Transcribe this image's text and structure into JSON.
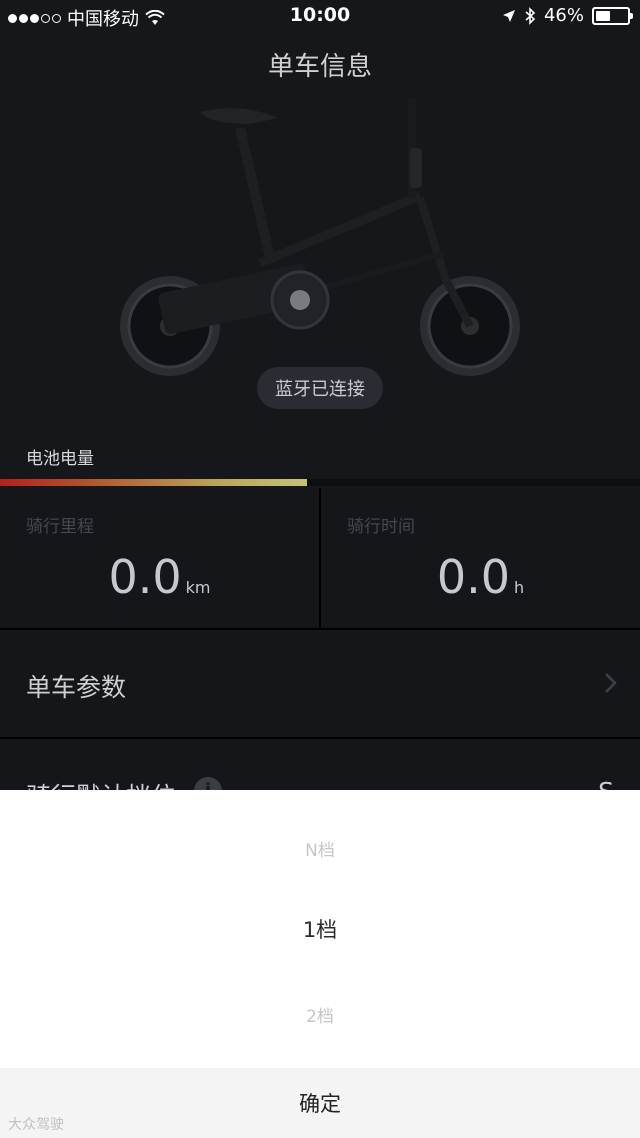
{
  "status_bar": {
    "carrier": "中国移动",
    "time": "10:00",
    "battery_percent": "46%",
    "battery_level": 0.46,
    "signal_bars_filled": 3,
    "signal_bars_total": 5
  },
  "header": {
    "title": "单车信息"
  },
  "bike": {
    "bluetooth_status": "蓝牙已连接",
    "battery_label": "电池电量",
    "battery_level": 0.48
  },
  "stats": [
    {
      "label": "骑行里程",
      "value": "0.0",
      "unit": "km"
    },
    {
      "label": "骑行时间",
      "value": "0.0",
      "unit": "h"
    }
  ],
  "rows": {
    "bike_params_label": "单车参数",
    "default_gear_label": "骑行默认档位",
    "default_gear_value": "S"
  },
  "picker": {
    "options": [
      "N档",
      "1档",
      "2档"
    ],
    "selected_index": 1,
    "confirm_label": "确定"
  },
  "watermark": "大众驾驶",
  "colors": {
    "background": "#16171b",
    "battery_gradient_start": "#b5201f",
    "battery_gradient_end": "#c4c378"
  }
}
